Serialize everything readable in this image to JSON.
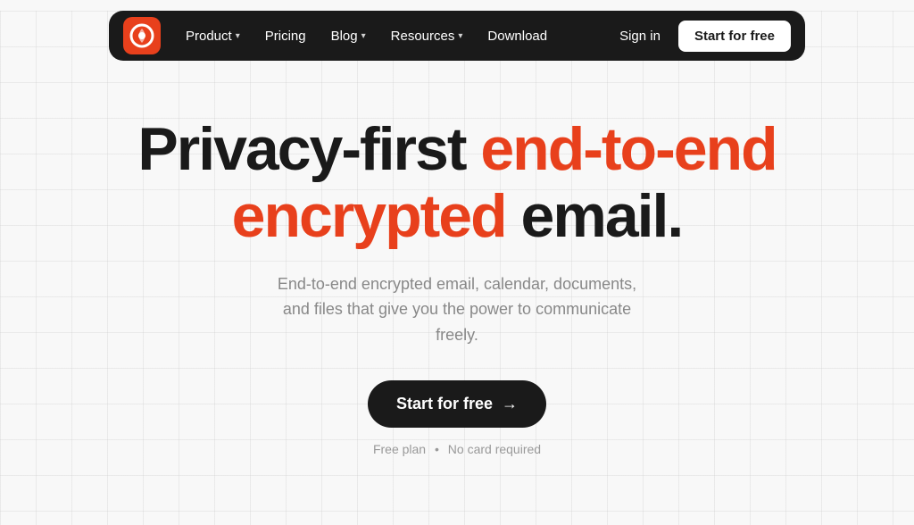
{
  "navbar": {
    "logo_alt": "Proton Mail logo",
    "items": [
      {
        "label": "Product",
        "has_dropdown": true,
        "id": "product"
      },
      {
        "label": "Pricing",
        "has_dropdown": false,
        "id": "pricing"
      },
      {
        "label": "Blog",
        "has_dropdown": true,
        "id": "blog"
      },
      {
        "label": "Resources",
        "has_dropdown": true,
        "id": "resources"
      },
      {
        "label": "Download",
        "has_dropdown": false,
        "id": "download"
      }
    ],
    "sign_in_label": "Sign in",
    "start_free_label": "Start for free"
  },
  "hero": {
    "heading_black_1": "Privacy-first ",
    "heading_accent": "end-to-end",
    "heading_newline": "",
    "heading_accent_2": "encrypted",
    "heading_black_2": " email.",
    "subtext": "End-to-end encrypted email, calendar, documents, and files that give you the power to communicate freely.",
    "cta_label": "Start for free",
    "cta_arrow": "→",
    "note_part1": "Free plan",
    "note_separator": "•",
    "note_part2": "No card required"
  },
  "colors": {
    "accent": "#e8401c",
    "dark": "#1a1a1a",
    "white": "#ffffff",
    "gray": "#888888"
  }
}
